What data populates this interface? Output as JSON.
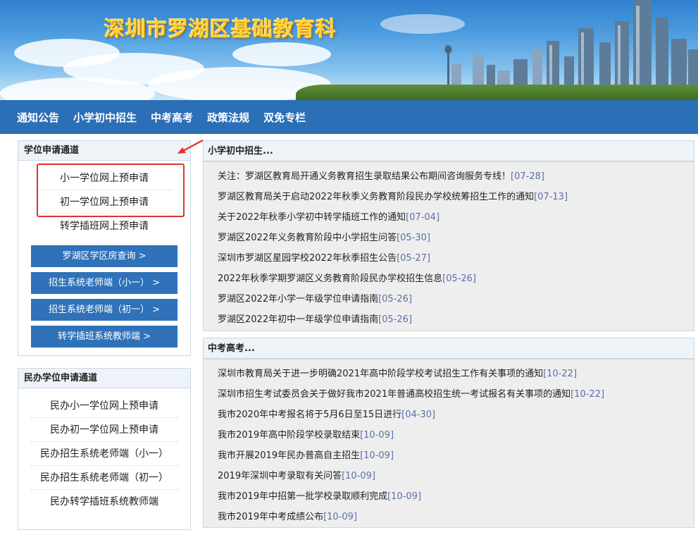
{
  "banner": {
    "title": "深圳市罗湖区基础教育科"
  },
  "nav": {
    "items": [
      "通知公告",
      "小学初中招生",
      "中考高考",
      "政策法规",
      "双免专栏"
    ]
  },
  "sidebar": {
    "apply": {
      "title": "学位申请通道",
      "links": [
        "小一学位网上预申请",
        "初一学位网上预申请",
        "转学插班网上预申请"
      ],
      "buttons": [
        "罗湖区学区房查询 >",
        "招生系统老师端（小一） >",
        "招生系统老师端（初一） >",
        "转学插班系统教师端 >"
      ]
    },
    "private": {
      "title": "民办学位申请通道",
      "links": [
        "民办小一学位网上预申请",
        "民办初一学位网上预申请",
        "民办招生系统老师端（小一）",
        "民办招生系统老师端（初一）",
        "民办转学插班系统教师端"
      ]
    }
  },
  "enrollment": {
    "title": "小学初中招生...",
    "items": [
      {
        "text": "关注：罗湖区教育局开通义务教育招生录取结果公布期间咨询服务专线！",
        "date": "[07-28]"
      },
      {
        "text": "罗湖区教育局关于启动2022年秋季义务教育阶段民办学校统筹招生工作的通知",
        "date": "[07-13]"
      },
      {
        "text": "关于2022年秋季小学初中转学插班工作的通知",
        "date": "[07-04]"
      },
      {
        "text": "罗湖区2022年义务教育阶段中小学招生问答",
        "date": "[05-30]"
      },
      {
        "text": "深圳市罗湖区星园学校2022年秋季招生公告",
        "date": "[05-27]"
      },
      {
        "text": "2022年秋季学期罗湖区义务教育阶段民办学校招生信息",
        "date": "[05-26]"
      },
      {
        "text": "罗湖区2022年小学一年级学位申请指南",
        "date": "[05-26]"
      },
      {
        "text": "罗湖区2022年初中一年级学位申请指南",
        "date": "[05-26]"
      }
    ]
  },
  "exams": {
    "title": "中考高考...",
    "items": [
      {
        "text": "深圳市教育局关于进一步明确2021年高中阶段学校考试招生工作有关事项的通知",
        "date": "[10-22]"
      },
      {
        "text": "深圳市招生考试委员会关于做好我市2021年普通高校招生统一考试报名有关事项的通知",
        "date": "[10-22]"
      },
      {
        "text": "我市2020年中考报名将于5月6日至15日进行",
        "date": "[04-30]"
      },
      {
        "text": "我市2019年高中阶段学校录取结束",
        "date": "[10-09]"
      },
      {
        "text": "我市开展2019年民办普高自主招生",
        "date": "[10-09]"
      },
      {
        "text": "2019年深圳中考录取有关问答",
        "date": "[10-09]"
      },
      {
        "text": "我市2019年中招第一批学校录取顺利完成",
        "date": "[10-09]"
      },
      {
        "text": "我市2019年中考成绩公布",
        "date": "[10-09]"
      }
    ]
  },
  "colors": {
    "nav": "#2b6fb6",
    "button": "#2f72b9",
    "highlight": "#e0322f",
    "date": "#5b6fa8"
  }
}
